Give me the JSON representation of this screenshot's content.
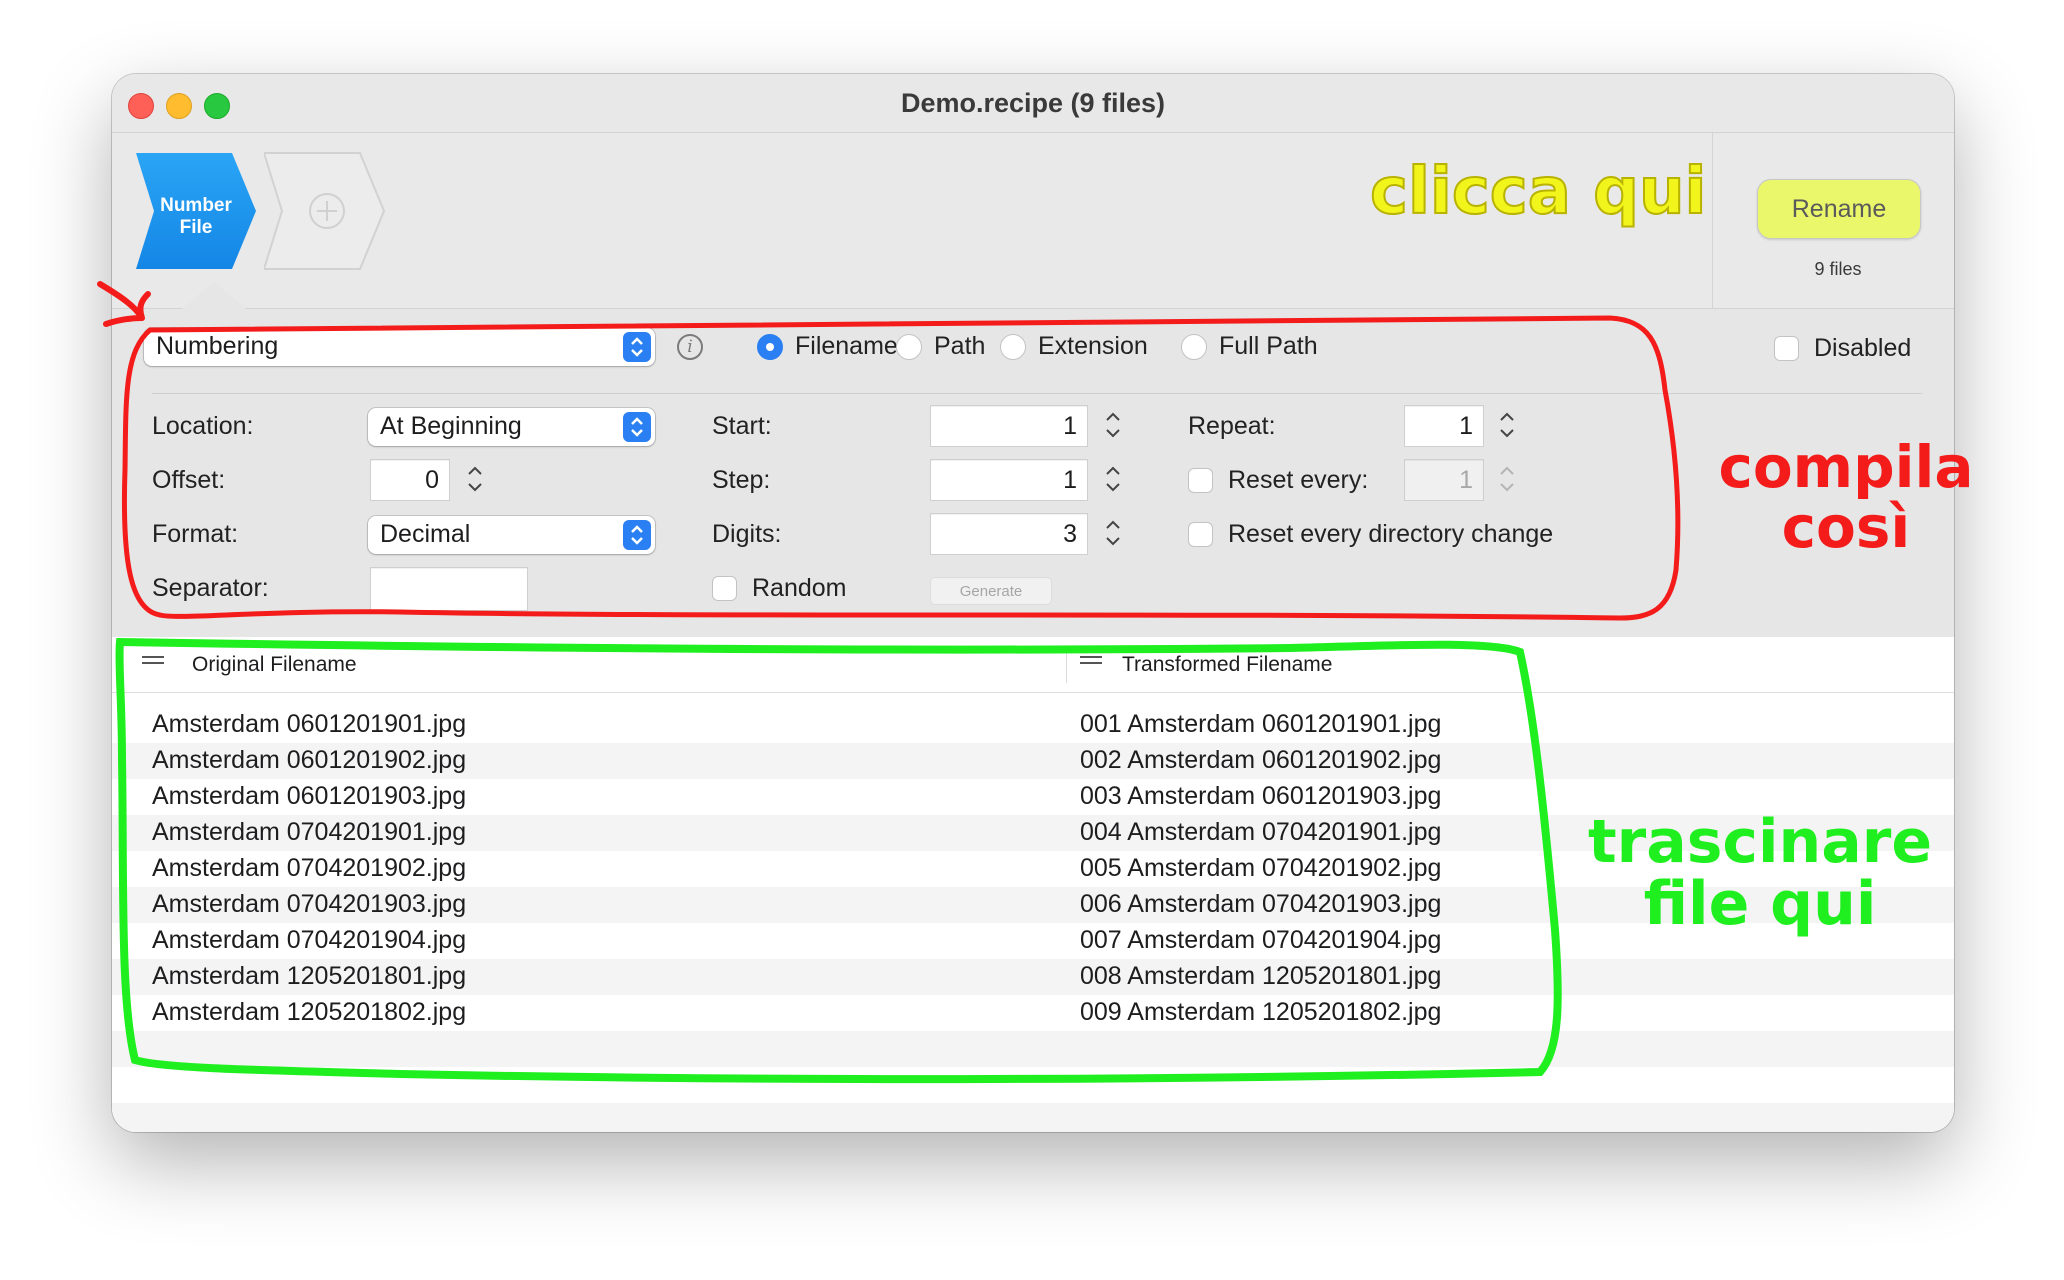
{
  "window": {
    "title": "Demo.recipe (9 files)"
  },
  "toolbar": {
    "action_tile": {
      "line1": "Number",
      "line2": "File"
    },
    "add_tile_icon": "plus-circle-icon",
    "rename_label": "Rename",
    "files_count": "9 files"
  },
  "settings": {
    "action_popup": "Numbering",
    "scope_options": [
      "Filename",
      "Path",
      "Extension",
      "Full Path"
    ],
    "scope_selected": "Filename",
    "disabled_label": "Disabled",
    "location_label": "Location:",
    "location_value": "At Beginning",
    "offset_label": "Offset:",
    "offset_value": "0",
    "format_label": "Format:",
    "format_value": "Decimal",
    "separator_label": "Separator:",
    "separator_value": "",
    "start_label": "Start:",
    "start_value": "1",
    "step_label": "Step:",
    "step_value": "1",
    "digits_label": "Digits:",
    "digits_value": "3",
    "random_label": "Random",
    "generate_label": "Generate",
    "repeat_label": "Repeat:",
    "repeat_value": "1",
    "reset_every_label": "Reset every:",
    "reset_every_value": "1",
    "reset_dir_label": "Reset every directory change"
  },
  "table": {
    "col_original": "Original Filename",
    "col_transformed": "Transformed Filename",
    "rows": [
      {
        "original": "Amsterdam 0601201901.jpg",
        "transformed": "001 Amsterdam 0601201901.jpg"
      },
      {
        "original": "Amsterdam 0601201902.jpg",
        "transformed": "002 Amsterdam 0601201902.jpg"
      },
      {
        "original": "Amsterdam 0601201903.jpg",
        "transformed": "003 Amsterdam 0601201903.jpg"
      },
      {
        "original": "Amsterdam 0704201901.jpg",
        "transformed": "004 Amsterdam 0704201901.jpg"
      },
      {
        "original": "Amsterdam 0704201902.jpg",
        "transformed": "005 Amsterdam 0704201902.jpg"
      },
      {
        "original": "Amsterdam 0704201903.jpg",
        "transformed": "006 Amsterdam 0704201903.jpg"
      },
      {
        "original": "Amsterdam 0704201904.jpg",
        "transformed": "007 Amsterdam 0704201904.jpg"
      },
      {
        "original": "Amsterdam 1205201801.jpg",
        "transformed": "008 Amsterdam 1205201801.jpg"
      },
      {
        "original": "Amsterdam 1205201802.jpg",
        "transformed": "009 Amsterdam 1205201802.jpg"
      }
    ]
  },
  "annotations": {
    "click_here": "clicca qui",
    "fill_line1": "compila",
    "fill_line2": "così",
    "drag_line1": "trascinare",
    "drag_line2": "file qui",
    "colors": {
      "yellow": "#f2f51c",
      "red": "#f41b1b",
      "green": "#1fee1f",
      "accent": "#2a7ff3"
    }
  }
}
